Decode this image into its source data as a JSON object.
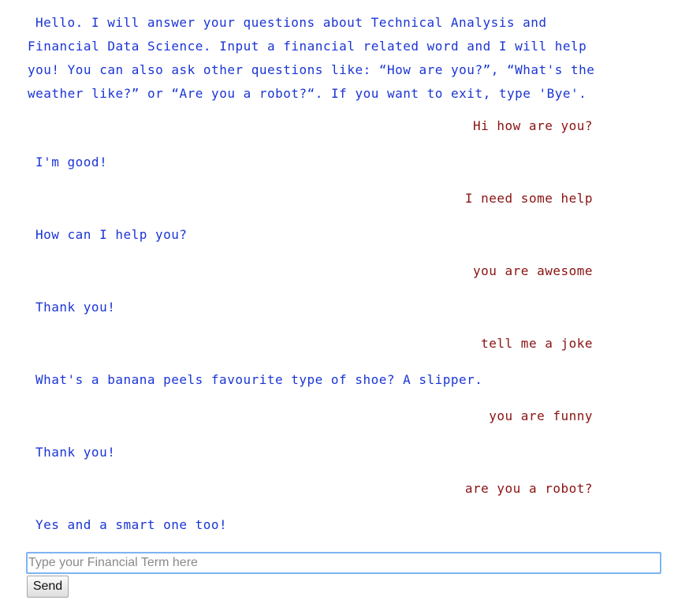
{
  "chat": {
    "intro": "Hello. I will answer your questions about Technical Analysis and Financial Data Science. Input a financial related word and I will help you! You can also ask other questions like: “How are you?”, “What's the weather like?” or “Are you a robot?“. If you want to exit, type 'Bye'.",
    "messages": [
      {
        "sender": "user",
        "text": "Hi how are you?"
      },
      {
        "sender": "bot",
        "text": "I'm good!"
      },
      {
        "sender": "user",
        "text": "I need some help"
      },
      {
        "sender": "bot",
        "text": "How can I help you?"
      },
      {
        "sender": "user",
        "text": "you are awesome"
      },
      {
        "sender": "bot",
        "text": "Thank you!"
      },
      {
        "sender": "user",
        "text": "tell me a joke"
      },
      {
        "sender": "bot",
        "text": "What's a banana peels favourite type of shoe? A slipper."
      },
      {
        "sender": "user",
        "text": "you are funny"
      },
      {
        "sender": "bot",
        "text": "Thank you!"
      },
      {
        "sender": "user",
        "text": "are you a robot?"
      },
      {
        "sender": "bot",
        "text": "Yes and a smart one too!"
      }
    ]
  },
  "input": {
    "value": "",
    "placeholder": "Type your Financial Term here"
  },
  "send": {
    "label": "Send"
  },
  "colors": {
    "bot_text": "#1b35d4",
    "user_text": "#8b1212",
    "input_focus_border": "#7fb4f2"
  }
}
